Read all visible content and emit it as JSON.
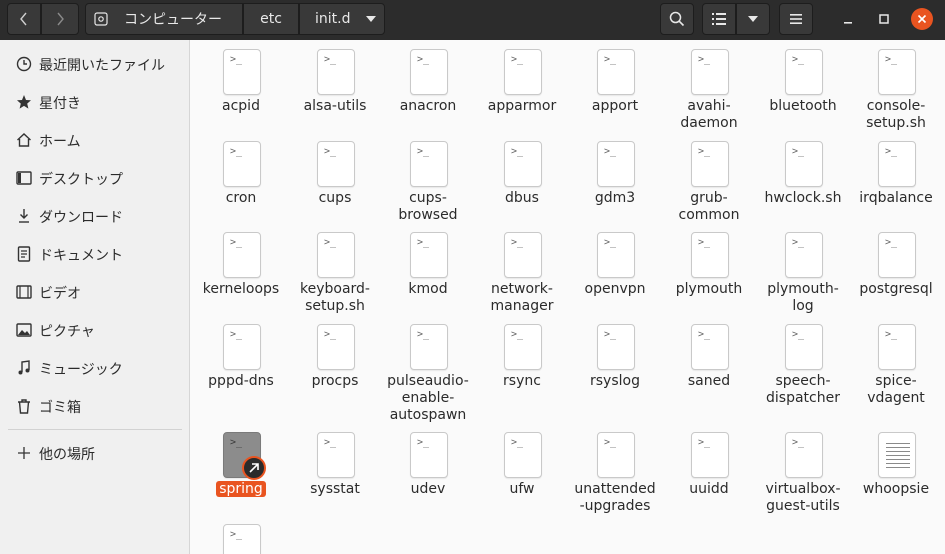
{
  "header": {
    "location": [
      "コンピューター",
      "etc",
      "init.d"
    ],
    "icons": {
      "back": "chevron-left-icon",
      "forward": "chevron-right-icon",
      "drive": "drive-icon",
      "path_menu": "chevron-down-icon",
      "search": "search-icon",
      "view_list": "list-view-icon",
      "view_options": "chevron-down-icon",
      "menu": "hamburger-menu-icon",
      "minimize": "minimize-icon",
      "maximize": "maximize-icon",
      "close": "close-icon"
    },
    "close_color": "#e95420"
  },
  "sidebar": {
    "items": [
      {
        "label": "最近開いたファイル",
        "icon": "clock-icon"
      },
      {
        "label": "星付き",
        "icon": "star-icon"
      },
      {
        "label": "ホーム",
        "icon": "home-icon"
      },
      {
        "label": "デスクトップ",
        "icon": "desktop-icon"
      },
      {
        "label": "ダウンロード",
        "icon": "download-icon"
      },
      {
        "label": "ドキュメント",
        "icon": "document-icon"
      },
      {
        "label": "ビデオ",
        "icon": "video-icon"
      },
      {
        "label": "ピクチャ",
        "icon": "picture-icon"
      },
      {
        "label": "ミュージック",
        "icon": "music-icon"
      },
      {
        "label": "ゴミ箱",
        "icon": "trash-icon"
      }
    ],
    "other": {
      "label": "他の場所",
      "icon": "plus-icon"
    }
  },
  "files": {
    "icon_glyph": ">_",
    "selected_color": "#e95420",
    "items": [
      {
        "name": "acpid"
      },
      {
        "name": "alsa-utils"
      },
      {
        "name": "anacron"
      },
      {
        "name": "apparmor"
      },
      {
        "name": "apport"
      },
      {
        "name": "avahi-\ndaemon"
      },
      {
        "name": "bluetooth"
      },
      {
        "name": "console-\nsetup.sh"
      },
      {
        "name": "cron"
      },
      {
        "name": "cups"
      },
      {
        "name": "cups-\nbrowsed"
      },
      {
        "name": "dbus"
      },
      {
        "name": "gdm3"
      },
      {
        "name": "grub-\ncommon"
      },
      {
        "name": "hwclock.sh"
      },
      {
        "name": "irqbalance"
      },
      {
        "name": "kerneloops"
      },
      {
        "name": "keyboard-\nsetup.sh"
      },
      {
        "name": "kmod"
      },
      {
        "name": "network-\nmanager"
      },
      {
        "name": "openvpn"
      },
      {
        "name": "plymouth"
      },
      {
        "name": "plymouth-\nlog"
      },
      {
        "name": "postgresql"
      },
      {
        "name": "pppd-dns"
      },
      {
        "name": "procps"
      },
      {
        "name": "pulseaudio-\nenable-\nautospawn"
      },
      {
        "name": "rsync"
      },
      {
        "name": "rsyslog"
      },
      {
        "name": "saned"
      },
      {
        "name": "speech-\ndispatcher"
      },
      {
        "name": "spice-\nvdagent"
      },
      {
        "name": "spring",
        "selected": true,
        "symlink": true
      },
      {
        "name": "sysstat"
      },
      {
        "name": "udev"
      },
      {
        "name": "ufw"
      },
      {
        "name": "unattended\n-upgrades"
      },
      {
        "name": "uuidd"
      },
      {
        "name": "virtualbox-\nguest-utils"
      },
      {
        "name": "whoopsie",
        "text_doc": true
      },
      {
        "name": ""
      }
    ]
  }
}
